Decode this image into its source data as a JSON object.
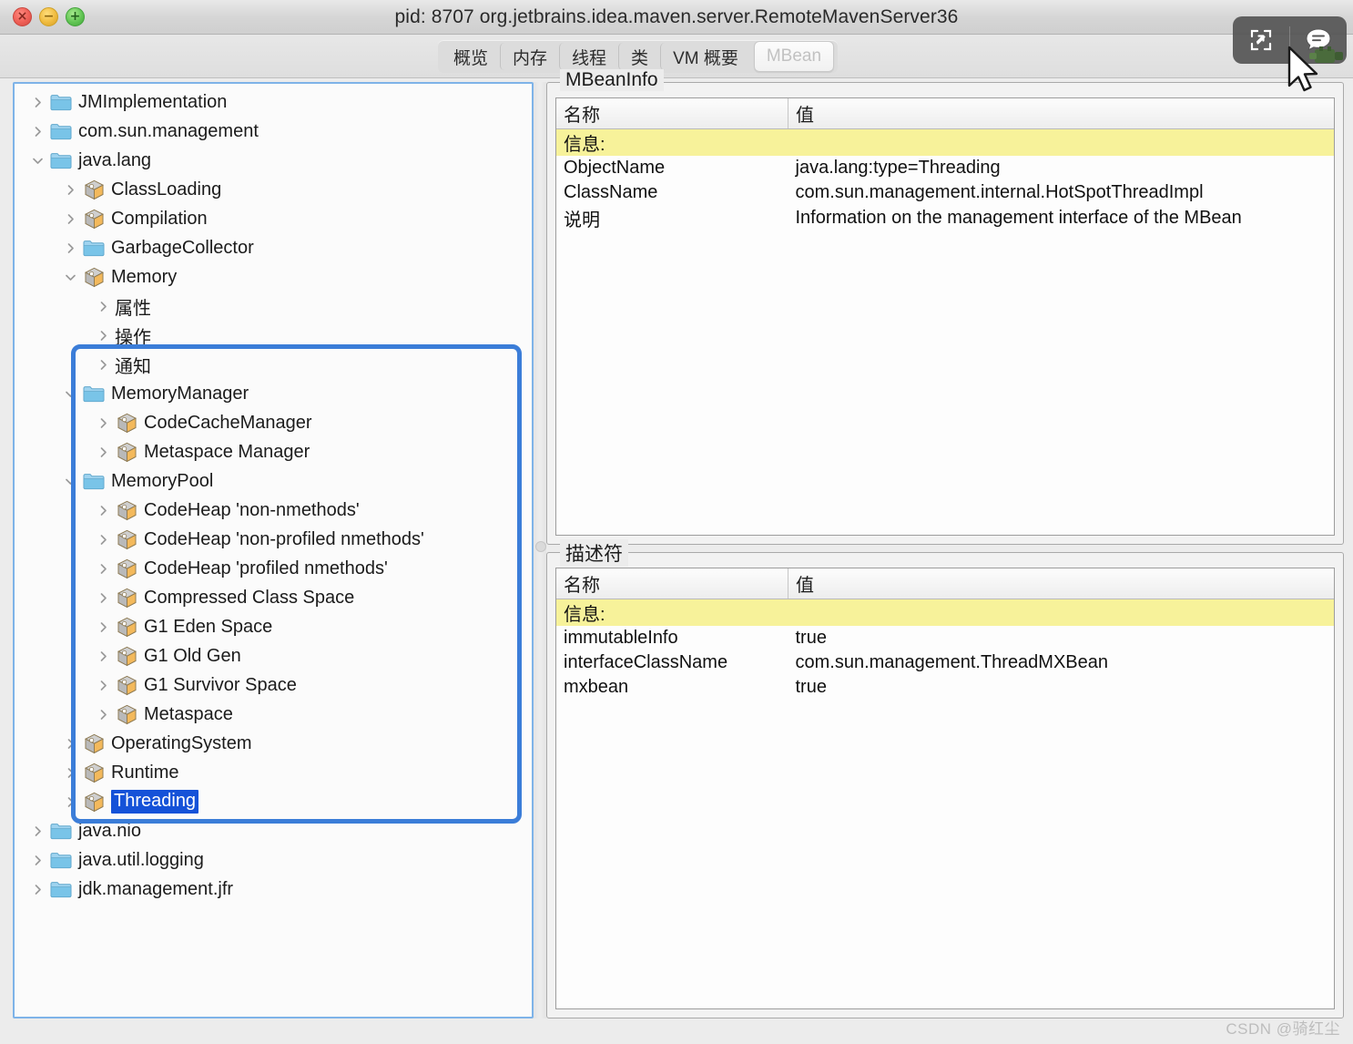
{
  "window": {
    "title": "pid: 8707 org.jetbrains.idea.maven.server.RemoteMavenServer36",
    "controls": {
      "close": "×",
      "minimize": "−",
      "zoom": "+"
    },
    "control_names": [
      "close-button",
      "minimize-button",
      "zoom-button"
    ]
  },
  "tabs": [
    {
      "label": "概览",
      "name": "tab-overview",
      "active": false
    },
    {
      "label": "内存",
      "name": "tab-memory",
      "active": false
    },
    {
      "label": "线程",
      "name": "tab-threads",
      "active": false
    },
    {
      "label": "类",
      "name": "tab-classes",
      "active": false
    },
    {
      "label": "VM 概要",
      "name": "tab-vm-summary",
      "active": false
    },
    {
      "label": "MBean",
      "name": "tab-mbean",
      "active": true
    }
  ],
  "overlay": {
    "expand_icon": "expand-icon",
    "comment_icon": "comment-icon"
  },
  "tree": {
    "nodes": [
      {
        "label": "JMImplementation",
        "indent": 0,
        "icon": "folder",
        "state": "collapsed"
      },
      {
        "label": "com.sun.management",
        "indent": 0,
        "icon": "folder",
        "state": "collapsed"
      },
      {
        "label": "java.lang",
        "indent": 0,
        "icon": "folder",
        "state": "expanded"
      },
      {
        "label": "ClassLoading",
        "indent": 1,
        "icon": "mbean",
        "state": "collapsed"
      },
      {
        "label": "Compilation",
        "indent": 1,
        "icon": "mbean",
        "state": "collapsed"
      },
      {
        "label": "GarbageCollector",
        "indent": 1,
        "icon": "folder",
        "state": "collapsed"
      },
      {
        "label": "Memory",
        "indent": 1,
        "icon": "mbean",
        "state": "expanded"
      },
      {
        "label": "属性",
        "indent": 2,
        "icon": "none",
        "state": "collapsed"
      },
      {
        "label": "操作",
        "indent": 2,
        "icon": "none",
        "state": "collapsed"
      },
      {
        "label": "通知",
        "indent": 2,
        "icon": "none",
        "state": "collapsed"
      },
      {
        "label": "MemoryManager",
        "indent": 1,
        "icon": "folder",
        "state": "expanded"
      },
      {
        "label": "CodeCacheManager",
        "indent": 2,
        "icon": "mbean",
        "state": "collapsed"
      },
      {
        "label": "Metaspace Manager",
        "indent": 2,
        "icon": "mbean",
        "state": "collapsed"
      },
      {
        "label": "MemoryPool",
        "indent": 1,
        "icon": "folder",
        "state": "expanded"
      },
      {
        "label": "CodeHeap 'non-nmethods'",
        "indent": 2,
        "icon": "mbean",
        "state": "collapsed"
      },
      {
        "label": "CodeHeap 'non-profiled nmethods'",
        "indent": 2,
        "icon": "mbean",
        "state": "collapsed"
      },
      {
        "label": "CodeHeap 'profiled nmethods'",
        "indent": 2,
        "icon": "mbean",
        "state": "collapsed"
      },
      {
        "label": "Compressed Class Space",
        "indent": 2,
        "icon": "mbean",
        "state": "collapsed"
      },
      {
        "label": "G1 Eden Space",
        "indent": 2,
        "icon": "mbean",
        "state": "collapsed"
      },
      {
        "label": "G1 Old Gen",
        "indent": 2,
        "icon": "mbean",
        "state": "collapsed"
      },
      {
        "label": "G1 Survivor Space",
        "indent": 2,
        "icon": "mbean",
        "state": "collapsed"
      },
      {
        "label": "Metaspace",
        "indent": 2,
        "icon": "mbean",
        "state": "collapsed"
      },
      {
        "label": "OperatingSystem",
        "indent": 1,
        "icon": "mbean",
        "state": "collapsed"
      },
      {
        "label": "Runtime",
        "indent": 1,
        "icon": "mbean",
        "state": "collapsed"
      },
      {
        "label": "Threading",
        "indent": 1,
        "icon": "mbean",
        "state": "collapsed",
        "selected": true
      },
      {
        "label": "java.nio",
        "indent": 0,
        "icon": "folder",
        "state": "collapsed"
      },
      {
        "label": "java.util.logging",
        "indent": 0,
        "icon": "folder",
        "state": "collapsed"
      },
      {
        "label": "jdk.management.jfr",
        "indent": 0,
        "icon": "folder",
        "state": "collapsed"
      }
    ]
  },
  "mbeaninfo": {
    "title": "MBeanInfo",
    "columns": [
      "名称",
      "值"
    ],
    "rows": [
      {
        "name": "信息:",
        "value": "",
        "highlight": true
      },
      {
        "name": "ObjectName",
        "value": "java.lang:type=Threading"
      },
      {
        "name": "ClassName",
        "value": "com.sun.management.internal.HotSpotThreadImpl"
      },
      {
        "name": "说明",
        "value": "Information on the management interface of the MBean"
      }
    ]
  },
  "descriptor": {
    "title": "描述符",
    "columns": [
      "名称",
      "值"
    ],
    "rows": [
      {
        "name": "信息:",
        "value": "",
        "highlight": true
      },
      {
        "name": "immutableInfo",
        "value": "true"
      },
      {
        "name": "interfaceClassName",
        "value": "com.sun.management.ThreadMXBean"
      },
      {
        "name": "mxbean",
        "value": "true"
      }
    ]
  },
  "annotation": {
    "name": "highlight-rectangle",
    "color": "#3b7dd8"
  },
  "watermark": "CSDN @骑红尘",
  "colors": {
    "selection_blue": "#1552d8",
    "highlight_yellow": "#f7f29a",
    "panel_focus_border": "#7eb3e8",
    "annotation_blue": "#3b7dd8"
  }
}
